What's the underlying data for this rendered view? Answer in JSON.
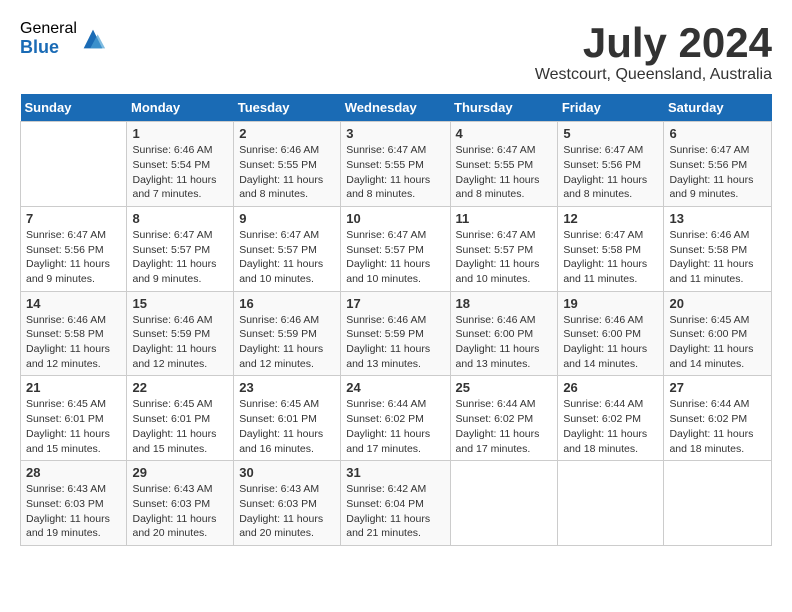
{
  "logo": {
    "general": "General",
    "blue": "Blue"
  },
  "title": "July 2024",
  "location": "Westcourt, Queensland, Australia",
  "weekdays": [
    "Sunday",
    "Monday",
    "Tuesday",
    "Wednesday",
    "Thursday",
    "Friday",
    "Saturday"
  ],
  "weeks": [
    [
      {
        "day": "",
        "info": ""
      },
      {
        "day": "1",
        "info": "Sunrise: 6:46 AM\nSunset: 5:54 PM\nDaylight: 11 hours\nand 7 minutes."
      },
      {
        "day": "2",
        "info": "Sunrise: 6:46 AM\nSunset: 5:55 PM\nDaylight: 11 hours\nand 8 minutes."
      },
      {
        "day": "3",
        "info": "Sunrise: 6:47 AM\nSunset: 5:55 PM\nDaylight: 11 hours\nand 8 minutes."
      },
      {
        "day": "4",
        "info": "Sunrise: 6:47 AM\nSunset: 5:55 PM\nDaylight: 11 hours\nand 8 minutes."
      },
      {
        "day": "5",
        "info": "Sunrise: 6:47 AM\nSunset: 5:56 PM\nDaylight: 11 hours\nand 8 minutes."
      },
      {
        "day": "6",
        "info": "Sunrise: 6:47 AM\nSunset: 5:56 PM\nDaylight: 11 hours\nand 9 minutes."
      }
    ],
    [
      {
        "day": "7",
        "info": "Sunrise: 6:47 AM\nSunset: 5:56 PM\nDaylight: 11 hours\nand 9 minutes."
      },
      {
        "day": "8",
        "info": "Sunrise: 6:47 AM\nSunset: 5:57 PM\nDaylight: 11 hours\nand 9 minutes."
      },
      {
        "day": "9",
        "info": "Sunrise: 6:47 AM\nSunset: 5:57 PM\nDaylight: 11 hours\nand 10 minutes."
      },
      {
        "day": "10",
        "info": "Sunrise: 6:47 AM\nSunset: 5:57 PM\nDaylight: 11 hours\nand 10 minutes."
      },
      {
        "day": "11",
        "info": "Sunrise: 6:47 AM\nSunset: 5:57 PM\nDaylight: 11 hours\nand 10 minutes."
      },
      {
        "day": "12",
        "info": "Sunrise: 6:47 AM\nSunset: 5:58 PM\nDaylight: 11 hours\nand 11 minutes."
      },
      {
        "day": "13",
        "info": "Sunrise: 6:46 AM\nSunset: 5:58 PM\nDaylight: 11 hours\nand 11 minutes."
      }
    ],
    [
      {
        "day": "14",
        "info": "Sunrise: 6:46 AM\nSunset: 5:58 PM\nDaylight: 11 hours\nand 12 minutes."
      },
      {
        "day": "15",
        "info": "Sunrise: 6:46 AM\nSunset: 5:59 PM\nDaylight: 11 hours\nand 12 minutes."
      },
      {
        "day": "16",
        "info": "Sunrise: 6:46 AM\nSunset: 5:59 PM\nDaylight: 11 hours\nand 12 minutes."
      },
      {
        "day": "17",
        "info": "Sunrise: 6:46 AM\nSunset: 5:59 PM\nDaylight: 11 hours\nand 13 minutes."
      },
      {
        "day": "18",
        "info": "Sunrise: 6:46 AM\nSunset: 6:00 PM\nDaylight: 11 hours\nand 13 minutes."
      },
      {
        "day": "19",
        "info": "Sunrise: 6:46 AM\nSunset: 6:00 PM\nDaylight: 11 hours\nand 14 minutes."
      },
      {
        "day": "20",
        "info": "Sunrise: 6:45 AM\nSunset: 6:00 PM\nDaylight: 11 hours\nand 14 minutes."
      }
    ],
    [
      {
        "day": "21",
        "info": "Sunrise: 6:45 AM\nSunset: 6:01 PM\nDaylight: 11 hours\nand 15 minutes."
      },
      {
        "day": "22",
        "info": "Sunrise: 6:45 AM\nSunset: 6:01 PM\nDaylight: 11 hours\nand 15 minutes."
      },
      {
        "day": "23",
        "info": "Sunrise: 6:45 AM\nSunset: 6:01 PM\nDaylight: 11 hours\nand 16 minutes."
      },
      {
        "day": "24",
        "info": "Sunrise: 6:44 AM\nSunset: 6:02 PM\nDaylight: 11 hours\nand 17 minutes."
      },
      {
        "day": "25",
        "info": "Sunrise: 6:44 AM\nSunset: 6:02 PM\nDaylight: 11 hours\nand 17 minutes."
      },
      {
        "day": "26",
        "info": "Sunrise: 6:44 AM\nSunset: 6:02 PM\nDaylight: 11 hours\nand 18 minutes."
      },
      {
        "day": "27",
        "info": "Sunrise: 6:44 AM\nSunset: 6:02 PM\nDaylight: 11 hours\nand 18 minutes."
      }
    ],
    [
      {
        "day": "28",
        "info": "Sunrise: 6:43 AM\nSunset: 6:03 PM\nDaylight: 11 hours\nand 19 minutes."
      },
      {
        "day": "29",
        "info": "Sunrise: 6:43 AM\nSunset: 6:03 PM\nDaylight: 11 hours\nand 20 minutes."
      },
      {
        "day": "30",
        "info": "Sunrise: 6:43 AM\nSunset: 6:03 PM\nDaylight: 11 hours\nand 20 minutes."
      },
      {
        "day": "31",
        "info": "Sunrise: 6:42 AM\nSunset: 6:04 PM\nDaylight: 11 hours\nand 21 minutes."
      },
      {
        "day": "",
        "info": ""
      },
      {
        "day": "",
        "info": ""
      },
      {
        "day": "",
        "info": ""
      }
    ]
  ]
}
